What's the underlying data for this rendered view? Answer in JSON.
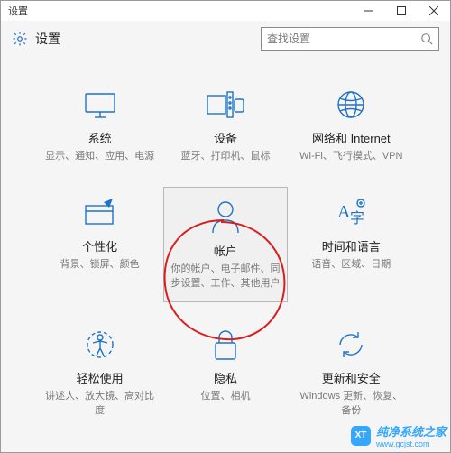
{
  "window": {
    "title": "设置"
  },
  "header": {
    "title": "设置"
  },
  "search": {
    "placeholder": "查找设置"
  },
  "tiles": {
    "system": {
      "title": "系统",
      "sub": "显示、通知、应用、电源"
    },
    "devices": {
      "title": "设备",
      "sub": "蓝牙、打印机、鼠标"
    },
    "network": {
      "title": "网络和 Internet",
      "sub": "Wi-Fi、飞行模式、VPN"
    },
    "personal": {
      "title": "个性化",
      "sub": "背景、锁屏、颜色"
    },
    "accounts": {
      "title": "帐户",
      "sub": "你的帐户、电子邮件、同步设置、工作、其他用户"
    },
    "time": {
      "title": "时间和语言",
      "sub": "语音、区域、日期"
    },
    "ease": {
      "title": "轻松使用",
      "sub": "讲述人、放大镜、高对比度"
    },
    "privacy": {
      "title": "隐私",
      "sub": "位置、相机"
    },
    "update": {
      "title": "更新和安全",
      "sub": "Windows 更新、恢复、备份"
    }
  },
  "watermark": {
    "text": "纯净系统之家",
    "url": "www.gcjst.com",
    "badge": "XT"
  },
  "colors": {
    "accent": "#1e73c8",
    "annotation": "#d81e1e"
  }
}
